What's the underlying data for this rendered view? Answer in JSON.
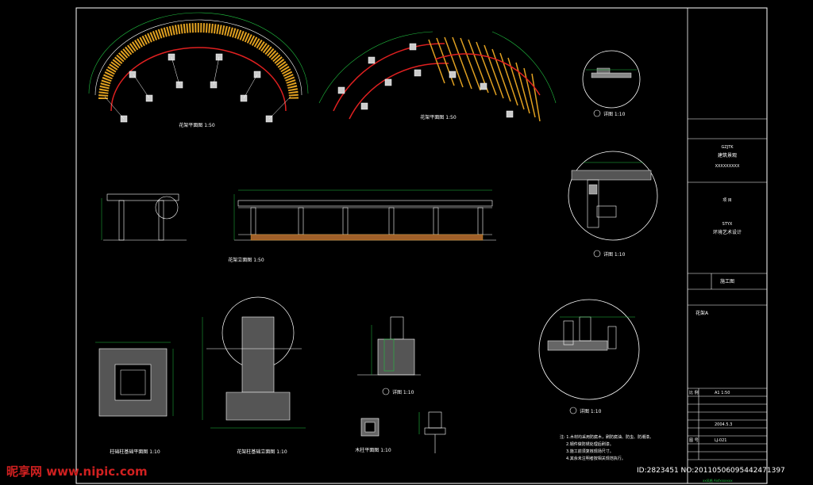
{
  "drawing_labels": {
    "plan_1": "花架平面图 1:50",
    "plan_2": "花架平面图 1:50",
    "elevation": "花架立面图 1:50",
    "detail_1": "详图 1:10",
    "detail_2": "详图 1:10",
    "detail_3": "详图 1:10",
    "detail_4": "详图 1:10",
    "column_base_plan": "柱础柱基础平面图 1:10",
    "column_base_section": "花架柱基础立面图 1:10",
    "column_plan": "木柱平面图 1:10",
    "notes": [
      "注: 1.木材均采用防腐木，刷防腐油、防虫、防潮漆。",
      "2.钢件做防锈处理后刷漆。",
      "3.施工前须复核现场尺寸。",
      "4.其余未注明者按相关规范执行。"
    ]
  },
  "title_block": {
    "org_line_1": "GZJTK",
    "org_line_2": "建筑景观",
    "org_code": "XXXXXXXXX",
    "project_label": "项 目",
    "project_name_en": "STYX",
    "project_name": "环境艺术设计",
    "stage_label": "施工图",
    "drawing_title": "花架A",
    "scale_label": "比 例",
    "scale_value": "A1 1:50",
    "date_value": "2004.5.3",
    "sheet_label": "图 号",
    "sheet_value": "LJ-021"
  },
  "watermark": {
    "brand": "昵享网 www.nipic.com",
    "id_text": "ID:2823451 NO:20110506095442471397",
    "bottom_caption": "xx风格 Aisfxsxxxxx"
  },
  "colors": {
    "background": "#000000",
    "lines": "#ffffff",
    "red": "#e02020",
    "orange": "#e0a020",
    "green": "#20c040",
    "cyan": "#30c0e0",
    "watermark": "#d02020"
  }
}
